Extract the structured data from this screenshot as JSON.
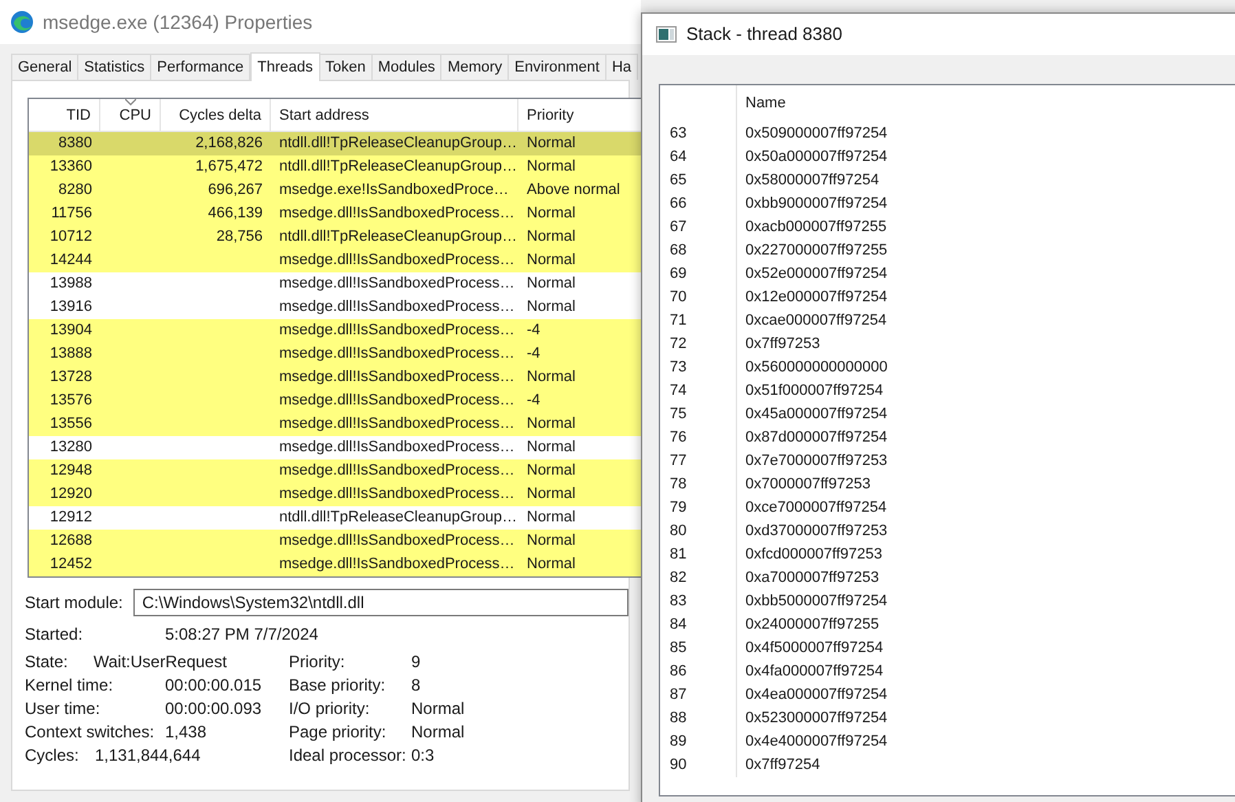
{
  "window": {
    "title": "msedge.exe (12364) Properties"
  },
  "tabs": [
    {
      "label": "General",
      "selected": false
    },
    {
      "label": "Statistics",
      "selected": false
    },
    {
      "label": "Performance",
      "selected": false
    },
    {
      "label": "Threads",
      "selected": true
    },
    {
      "label": "Token",
      "selected": false
    },
    {
      "label": "Modules",
      "selected": false
    },
    {
      "label": "Memory",
      "selected": false
    },
    {
      "label": "Environment",
      "selected": false
    },
    {
      "label": "Ha",
      "selected": false
    }
  ],
  "threads": {
    "columns": [
      "TID",
      "CPU",
      "Cycles delta",
      "Start address",
      "Priority"
    ],
    "rows": [
      {
        "tid": "8380",
        "cycles": "2,168,826",
        "start": "ntdll.dll!TpReleaseCleanupGroup…",
        "priority": "Normal",
        "highlight": true,
        "selected": true
      },
      {
        "tid": "13360",
        "cycles": "1,675,472",
        "start": "ntdll.dll!TpReleaseCleanupGroup…",
        "priority": "Normal",
        "highlight": true,
        "selected": false
      },
      {
        "tid": "8280",
        "cycles": "696,267",
        "start": "msedge.exe!IsSandboxedProce…",
        "priority": "Above normal",
        "highlight": true,
        "selected": false
      },
      {
        "tid": "11756",
        "cycles": "466,139",
        "start": "msedge.dll!IsSandboxedProcess…",
        "priority": "Normal",
        "highlight": true,
        "selected": false
      },
      {
        "tid": "10712",
        "cycles": "28,756",
        "start": "ntdll.dll!TpReleaseCleanupGroup…",
        "priority": "Normal",
        "highlight": true,
        "selected": false
      },
      {
        "tid": "14244",
        "start": "msedge.dll!IsSandboxedProcess…",
        "priority": "Normal",
        "highlight": true,
        "selected": false
      },
      {
        "tid": "13988",
        "start": "msedge.dll!IsSandboxedProcess…",
        "priority": "Normal",
        "highlight": false,
        "selected": false
      },
      {
        "tid": "13916",
        "start": "msedge.dll!IsSandboxedProcess…",
        "priority": "Normal",
        "highlight": false,
        "selected": false
      },
      {
        "tid": "13904",
        "start": "msedge.dll!IsSandboxedProcess…",
        "priority": "-4",
        "highlight": true,
        "selected": false
      },
      {
        "tid": "13888",
        "start": "msedge.dll!IsSandboxedProcess…",
        "priority": "-4",
        "highlight": true,
        "selected": false
      },
      {
        "tid": "13728",
        "start": "msedge.dll!IsSandboxedProcess…",
        "priority": "Normal",
        "highlight": true,
        "selected": false
      },
      {
        "tid": "13576",
        "start": "msedge.dll!IsSandboxedProcess…",
        "priority": "-4",
        "highlight": true,
        "selected": false
      },
      {
        "tid": "13556",
        "start": "msedge.dll!IsSandboxedProcess…",
        "priority": "Normal",
        "highlight": true,
        "selected": false
      },
      {
        "tid": "13280",
        "start": "msedge.dll!IsSandboxedProcess…",
        "priority": "Normal",
        "highlight": false,
        "selected": false
      },
      {
        "tid": "12948",
        "start": "msedge.dll!IsSandboxedProcess…",
        "priority": "Normal",
        "highlight": true,
        "selected": false
      },
      {
        "tid": "12920",
        "start": "msedge.dll!IsSandboxedProcess…",
        "priority": "Normal",
        "highlight": true,
        "selected": false
      },
      {
        "tid": "12912",
        "start": "ntdll.dll!TpReleaseCleanupGroup…",
        "priority": "Normal",
        "highlight": false,
        "selected": false
      },
      {
        "tid": "12688",
        "start": "msedge.dll!IsSandboxedProcess…",
        "priority": "Normal",
        "highlight": true,
        "selected": false
      },
      {
        "tid": "12452",
        "start": "msedge.dll!IsSandboxedProcess…",
        "priority": "Normal",
        "highlight": true,
        "selected": false
      }
    ]
  },
  "start_module": {
    "label": "Start module:",
    "value": "C:\\Windows\\System32\\ntdll.dll"
  },
  "started": {
    "label": "Started:",
    "value": "5:08:27 PM 7/7/2024"
  },
  "details_left": [
    {
      "label": "State:",
      "value": "Wait:UserRequest"
    },
    {
      "label": "Kernel time:",
      "value": "00:00:00.015"
    },
    {
      "label": "User time:",
      "value": "00:00:00.093"
    },
    {
      "label": "Context switches:",
      "value": "1,438"
    },
    {
      "label": "Cycles:",
      "value": "1,131,844,644"
    }
  ],
  "details_right": [
    {
      "label": "Priority:",
      "value": "9"
    },
    {
      "label": "Base priority:",
      "value": "8"
    },
    {
      "label": "I/O priority:",
      "value": "Normal"
    },
    {
      "label": "Page priority:",
      "value": "Normal"
    },
    {
      "label": "Ideal processor:",
      "value": "0:3"
    }
  ],
  "stack_window": {
    "title": "Stack - thread 8380",
    "column": "Name",
    "frames": [
      {
        "index": "63",
        "name": "0x509000007ff97254"
      },
      {
        "index": "64",
        "name": "0x50a000007ff97254"
      },
      {
        "index": "65",
        "name": "0x58000007ff97254"
      },
      {
        "index": "66",
        "name": "0xbb9000007ff97254"
      },
      {
        "index": "67",
        "name": "0xacb000007ff97255"
      },
      {
        "index": "68",
        "name": "0x227000007ff97255"
      },
      {
        "index": "69",
        "name": "0x52e000007ff97254"
      },
      {
        "index": "70",
        "name": "0x12e000007ff97254"
      },
      {
        "index": "71",
        "name": "0xcae000007ff97254"
      },
      {
        "index": "72",
        "name": "0x7ff97253"
      },
      {
        "index": "73",
        "name": "0x560000000000000"
      },
      {
        "index": "74",
        "name": "0x51f000007ff97254"
      },
      {
        "index": "75",
        "name": "0x45a000007ff97254"
      },
      {
        "index": "76",
        "name": "0x87d000007ff97254"
      },
      {
        "index": "77",
        "name": "0x7e7000007ff97253"
      },
      {
        "index": "78",
        "name": "0x7000007ff97253"
      },
      {
        "index": "79",
        "name": "0xce7000007ff97254"
      },
      {
        "index": "80",
        "name": "0xd37000007ff97253"
      },
      {
        "index": "81",
        "name": "0xfcd000007ff97253"
      },
      {
        "index": "82",
        "name": "0xa7000007ff97253"
      },
      {
        "index": "83",
        "name": "0xbb5000007ff97254"
      },
      {
        "index": "84",
        "name": "0x24000007ff97255"
      },
      {
        "index": "85",
        "name": "0x4f5000007ff97254"
      },
      {
        "index": "86",
        "name": "0x4fa000007ff97254"
      },
      {
        "index": "87",
        "name": "0x4ea000007ff97254"
      },
      {
        "index": "88",
        "name": "0x523000007ff97254"
      },
      {
        "index": "89",
        "name": "0x4e4000007ff97254"
      },
      {
        "index": "90",
        "name": "0x7ff97254"
      }
    ]
  }
}
